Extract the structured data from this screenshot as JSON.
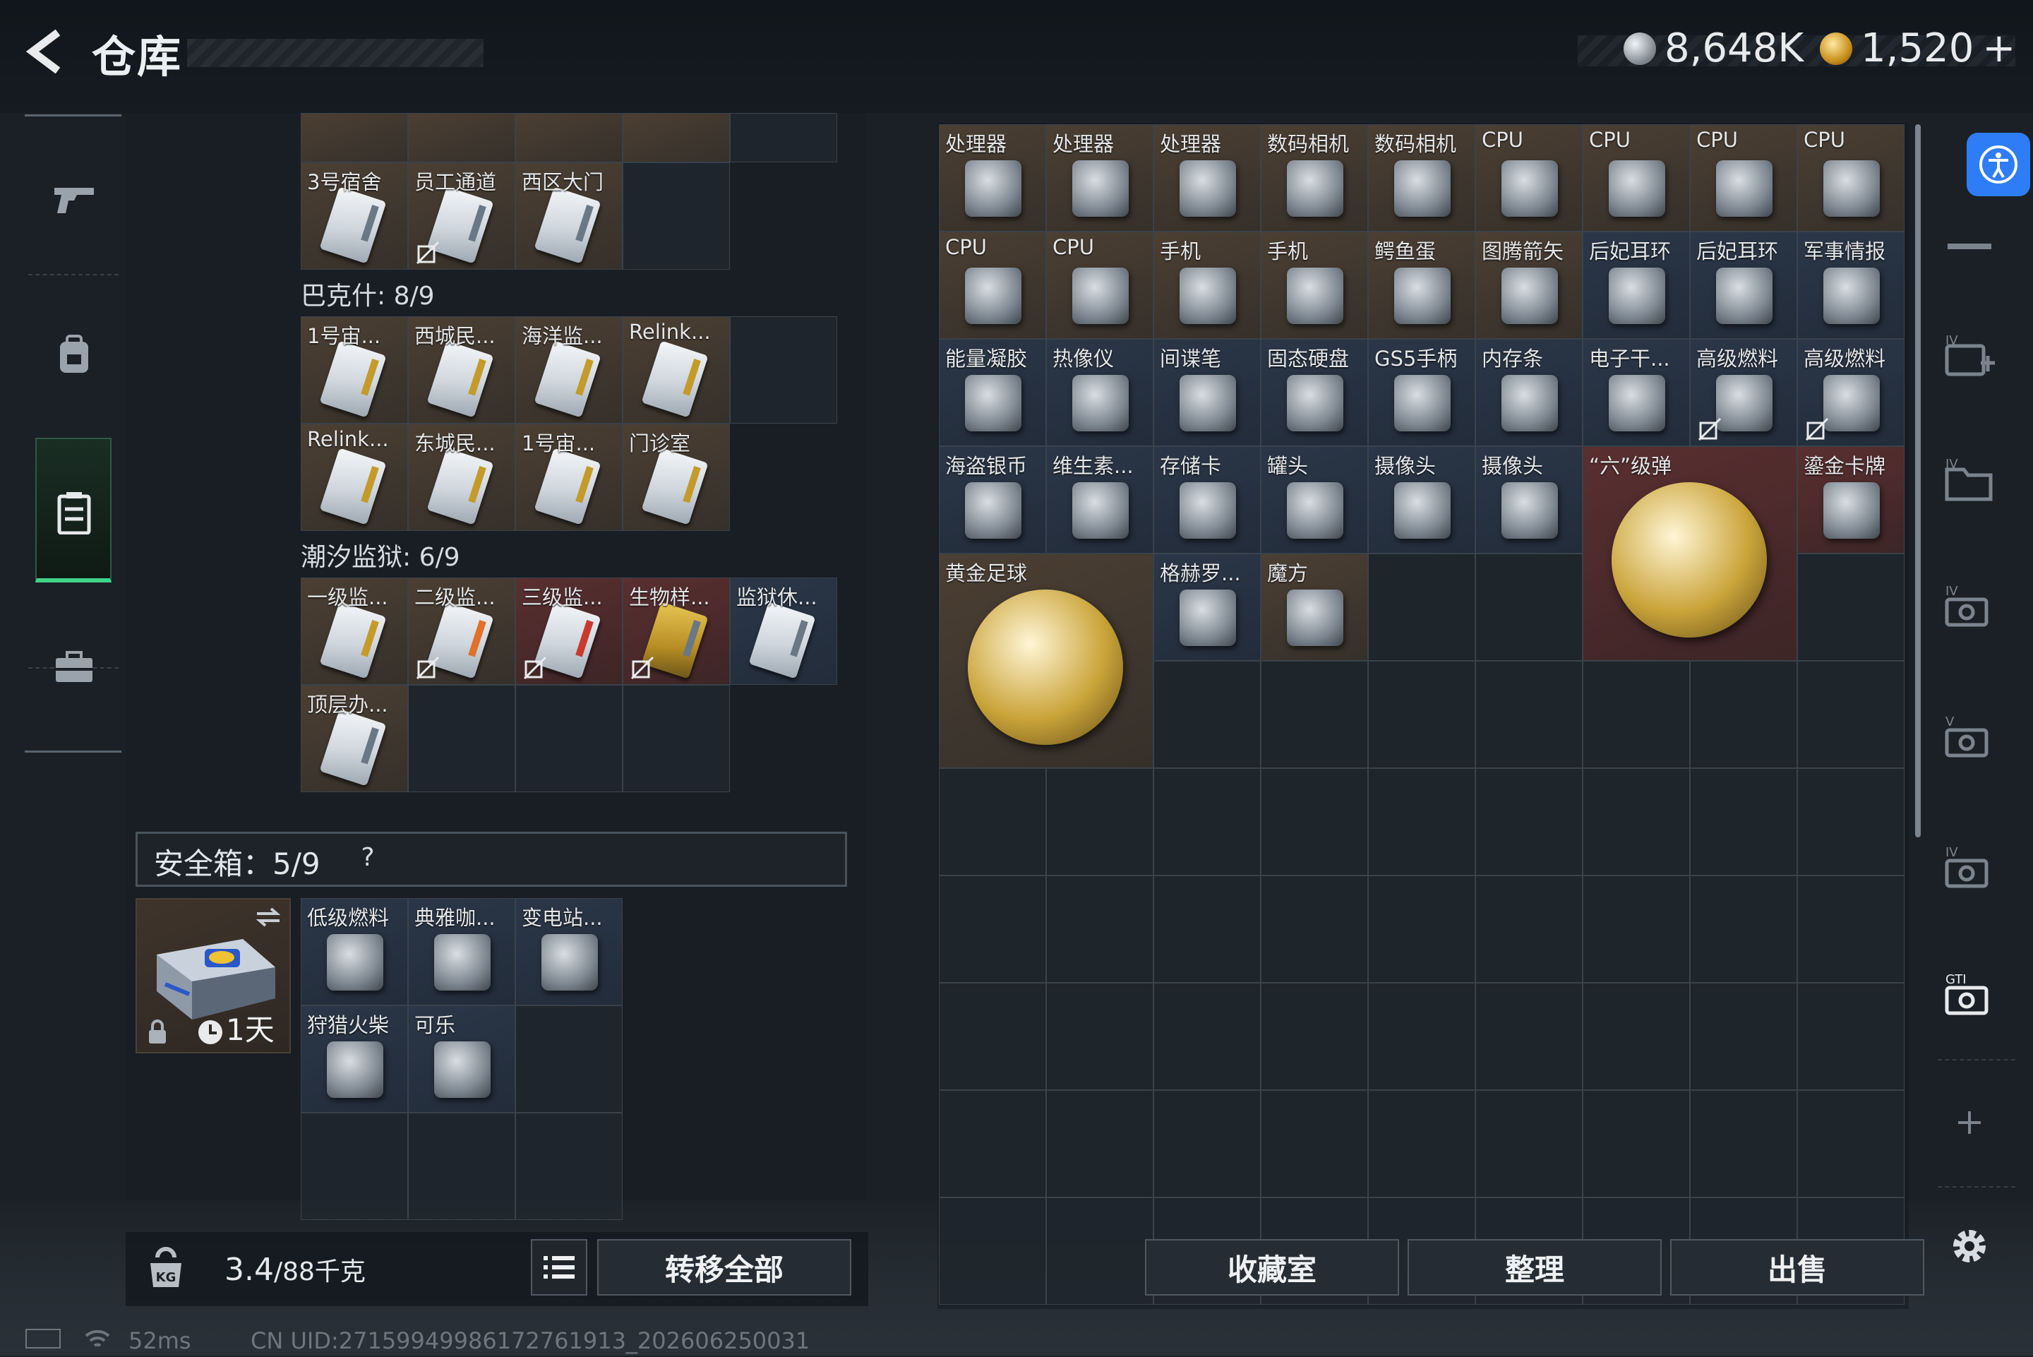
{
  "header": {
    "title": "仓库"
  },
  "currency": [
    {
      "name": "silver-coin",
      "value": "8,648K"
    },
    {
      "name": "gold-coin",
      "value": "1,520",
      "add": "+"
    }
  ],
  "left": {
    "top_partial": [
      {
        "label": "3号宿舍",
        "bg": "brown",
        "card": ""
      },
      {
        "label": "员工通道",
        "bg": "brown",
        "card": "",
        "locked": true
      },
      {
        "label": "西区大门",
        "bg": "brown",
        "card": ""
      },
      {
        "label": "",
        "bg": "empty"
      }
    ],
    "sections": [
      {
        "title": "巴克什: 8/9",
        "items": [
          {
            "label": "1号宙...",
            "bg": "brown",
            "card": "gold"
          },
          {
            "label": "西城民...",
            "bg": "brown",
            "card": "gold"
          },
          {
            "label": "海洋监...",
            "bg": "brown",
            "card": "gold"
          },
          {
            "label": "Relink...",
            "bg": "brown",
            "card": "gold"
          },
          {
            "label": "",
            "bg": "empty"
          },
          {
            "label": "Relink...",
            "bg": "brown",
            "card": "gold"
          },
          {
            "label": "东城民...",
            "bg": "brown",
            "card": "gold"
          },
          {
            "label": "1号宙...",
            "bg": "brown",
            "card": "gold"
          },
          {
            "label": "门诊室",
            "bg": "brown",
            "card": "gold"
          }
        ]
      },
      {
        "title": "潮汐监狱: 6/9",
        "items": [
          {
            "label": "一级监...",
            "bg": "brown",
            "card": "gold"
          },
          {
            "label": "二级监...",
            "bg": "brown",
            "card": "orange",
            "locked": true
          },
          {
            "label": "三级监...",
            "bg": "red",
            "card": "redc",
            "locked": true
          },
          {
            "label": "生物样...",
            "bg": "red",
            "card": "yellowc",
            "locked": true
          },
          {
            "label": "监狱休...",
            "bg": "blue",
            "card": ""
          },
          {
            "label": "顶层办...",
            "bg": "brown",
            "card": ""
          },
          {
            "label": "",
            "bg": "empty"
          },
          {
            "label": "",
            "bg": "empty"
          },
          {
            "label": "",
            "bg": "empty"
          }
        ]
      }
    ],
    "safebox": {
      "title": "安全箱：5/9",
      "help": "?",
      "timer": "1天",
      "items": [
        {
          "label": "低级燃料",
          "bg": "blue"
        },
        {
          "label": "典雅咖...",
          "bg": "blue"
        },
        {
          "label": "变电站...",
          "bg": "blue"
        },
        {
          "label": "狩猎火柴",
          "bg": "blue"
        },
        {
          "label": "可乐",
          "bg": "blue"
        },
        {
          "label": "",
          "bg": "empty"
        },
        {
          "label": "",
          "bg": "empty"
        },
        {
          "label": "",
          "bg": "empty"
        },
        {
          "label": "",
          "bg": "empty"
        }
      ]
    },
    "weight": {
      "value": "3.4",
      "max": "/88千克",
      "unit_icon": "KG"
    },
    "transfer_all": "转移全部"
  },
  "stash": {
    "items": [
      {
        "label": "处理器",
        "bg": "brown"
      },
      {
        "label": "处理器",
        "bg": "brown"
      },
      {
        "label": "处理器",
        "bg": "brown"
      },
      {
        "label": "数码相机",
        "bg": "brown"
      },
      {
        "label": "数码相机",
        "bg": "brown"
      },
      {
        "label": "CPU",
        "bg": "brown"
      },
      {
        "label": "CPU",
        "bg": "brown"
      },
      {
        "label": "CPU",
        "bg": "brown"
      },
      {
        "label": "CPU",
        "bg": "brown"
      },
      {
        "label": "CPU",
        "bg": "brown"
      },
      {
        "label": "CPU",
        "bg": "brown"
      },
      {
        "label": "手机",
        "bg": "brown"
      },
      {
        "label": "手机",
        "bg": "brown"
      },
      {
        "label": "鳄鱼蛋",
        "bg": "brown"
      },
      {
        "label": "图腾箭矢",
        "bg": "brown"
      },
      {
        "label": "后妃耳环",
        "bg": "blue"
      },
      {
        "label": "后妃耳环",
        "bg": "blue"
      },
      {
        "label": "军事情报",
        "bg": "blue"
      },
      {
        "label": "能量凝胶",
        "bg": "blue"
      },
      {
        "label": "热像仪",
        "bg": "blue"
      },
      {
        "label": "间谍笔",
        "bg": "blue"
      },
      {
        "label": "固态硬盘",
        "bg": "blue"
      },
      {
        "label": "GS5手柄",
        "bg": "blue"
      },
      {
        "label": "内存条",
        "bg": "blue"
      },
      {
        "label": "电子干...",
        "bg": "blue"
      },
      {
        "label": "高级燃料",
        "bg": "blue",
        "locked": true
      },
      {
        "label": "高级燃料",
        "bg": "blue",
        "locked": true
      },
      {
        "label": "海盗银币",
        "bg": "blue"
      },
      {
        "label": "维生素...",
        "bg": "blue"
      },
      {
        "label": "存储卡",
        "bg": "blue"
      },
      {
        "label": "罐头",
        "bg": "blue"
      },
      {
        "label": "摄像头",
        "bg": "blue"
      },
      {
        "label": "摄像头",
        "bg": "blue"
      },
      {
        "label": "“六”级弹",
        "bg": "red"
      },
      {
        "label": "鎏金卡牌",
        "bg": "red"
      },
      {
        "label": "黄金足球",
        "bg": "brown"
      },
      {
        "label": "格赫罗...",
        "bg": "blue"
      },
      {
        "label": "魔方",
        "bg": "brown"
      }
    ],
    "buttons": {
      "collection": "收藏室",
      "sort": "整理",
      "sell": "出售"
    }
  },
  "status": {
    "ping": "52ms",
    "uid": "CN UID:27159949986172761913_202606250031"
  }
}
